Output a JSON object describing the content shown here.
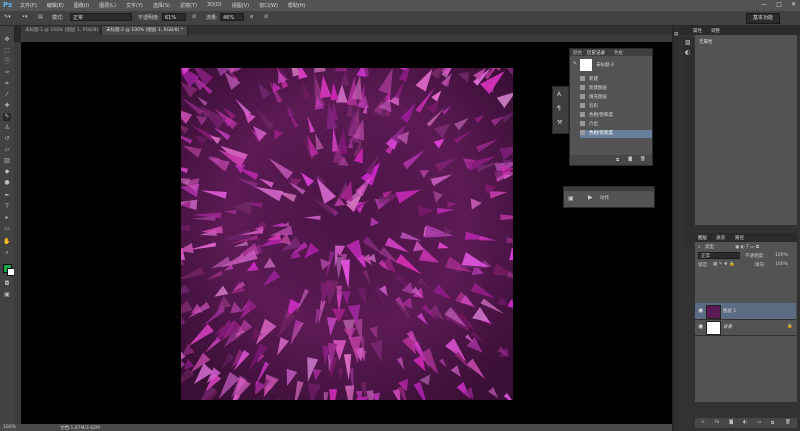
{
  "app": {
    "logo": "Ps"
  },
  "menu": [
    "文件(F)",
    "编辑(E)",
    "图像(I)",
    "图层(L)",
    "文字(Y)",
    "选择(S)",
    "滤镜(T)",
    "3D(D)",
    "视图(V)",
    "窗口(W)",
    "帮助(H)"
  ],
  "window_controls": [
    "—",
    "□",
    "✕"
  ],
  "options": {
    "mode_label": "模式:",
    "mode_value": "正常",
    "opacity_label": "不透明度:",
    "opacity_value": "61%",
    "flow_label": "流量:",
    "flow_value": "46%",
    "workspace": "基本功能"
  },
  "tabs": [
    {
      "label": "未标题-1 @ 100% (图层 1, RGB/8) *",
      "active": false
    },
    {
      "label": "未标题-2 @ 100% (图层 1, RGB/8) *",
      "active": true
    }
  ],
  "history_panel": {
    "tabs": [
      "颜色",
      "历史记录",
      "色板"
    ],
    "snapshot": "未标题-2",
    "rows": [
      "新建",
      "新建图层",
      "填充图层",
      "云彩",
      "色相/饱和度",
      "凸出",
      "色相/饱和度"
    ],
    "selected_index": 6
  },
  "actions_panel": {
    "row": "动作"
  },
  "properties_panel": {
    "tabs": [
      "属性",
      "调整"
    ],
    "body": "无属性"
  },
  "layers_panel": {
    "tabs": [
      "图层",
      "通道",
      "路径"
    ],
    "kind_label": "类型",
    "blend": "正常",
    "opacity_label": "不透明度:",
    "opacity": "100%",
    "lock_label": "锁定:",
    "fill_label": "填充:",
    "fill": "100%",
    "layers": [
      {
        "name": "图层 1",
        "selected": true
      },
      {
        "name": "背景",
        "selected": false
      }
    ]
  },
  "status": {
    "zoom": "100%",
    "doc": "文档:1.87M/3.62M"
  },
  "colors": {
    "foreground": "#1fa64a",
    "background": "#ffffff",
    "artwork_base": "#5c1a55",
    "selection": "#6a7f9b"
  }
}
